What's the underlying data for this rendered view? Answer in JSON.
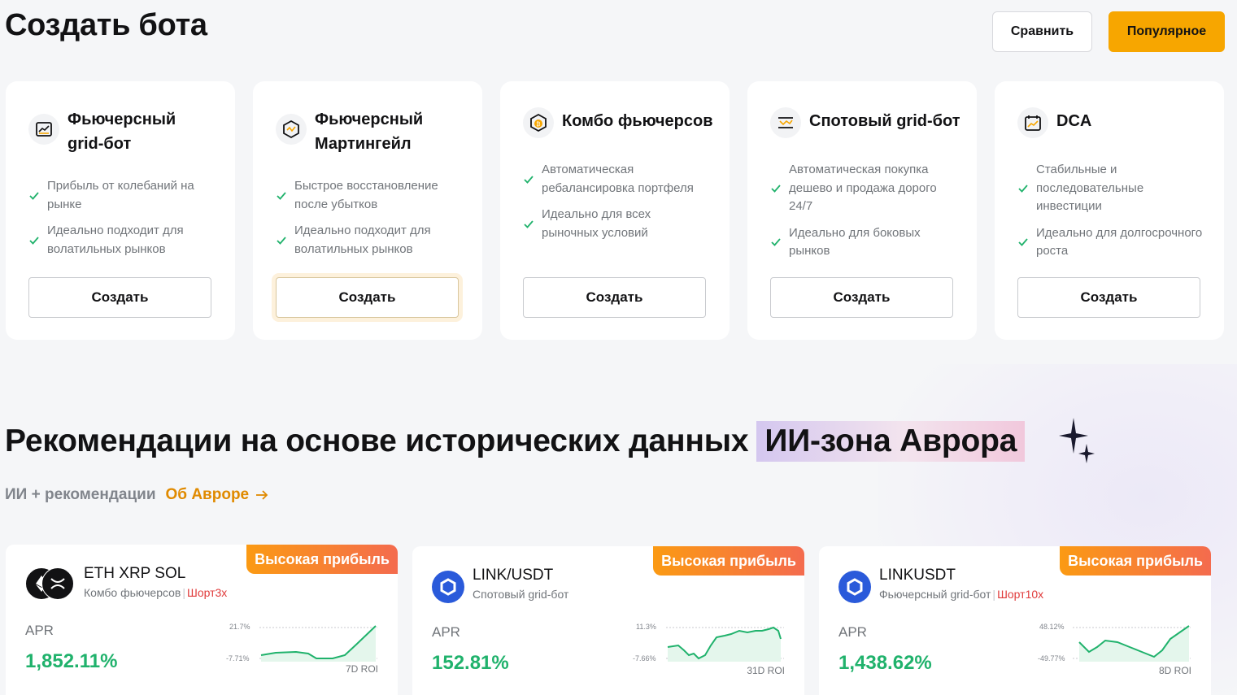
{
  "header": {
    "title": "Создать бота",
    "compare_label": "Сравнить",
    "popular_label": "Популярное"
  },
  "bots": [
    {
      "title": "Фьючерсный grid-бот",
      "icon": "futures-grid-icon",
      "features": [
        "Прибыль от колебаний на рынке",
        "Идеально подходит для волатильных рынков"
      ],
      "button": "Создать"
    },
    {
      "title": "Фьючерсный Мартингейл",
      "icon": "martingale-icon",
      "features": [
        "Быстрое восстановление после убытков",
        "Идеально подходит для волатильных рынков"
      ],
      "button": "Создать"
    },
    {
      "title": "Комбо фьючерсов",
      "icon": "combo-futures-icon",
      "features": [
        "Автоматическая ребалансировка портфеля",
        "Идеально для всех рыночных условий"
      ],
      "button": "Создать"
    },
    {
      "title": "Спотовый grid-бот",
      "icon": "spot-grid-icon",
      "features": [
        "Автоматическая покупка дешево и продажа дорого 24/7",
        "Идеально для боковых рынков"
      ],
      "button": "Создать"
    },
    {
      "title": "DCA",
      "icon": "dca-calendar-icon",
      "features": [
        "Стабильные и последовательные инвестиции",
        "Идеально для долгосрочного роста"
      ],
      "button": "Создать"
    }
  ],
  "recommendations": {
    "title_main": "Рекомендации на основе исторических данных",
    "title_highlight": "ИИ-зона Аврора",
    "subtitle": "ИИ + рекомендации",
    "about_link": "Об Авроре",
    "cards": [
      {
        "pair": "ETH XRP SOL",
        "type": "Комбо фьючерсов",
        "leverage": "Шорт3x",
        "badge": "Высокая прибыль",
        "apr_label": "APR",
        "apr": "1,852.11%",
        "roi_label": "7D ROI",
        "axis_max": "21.7%",
        "axis_min": "-7.71%"
      },
      {
        "pair": "LINK/USDT",
        "type": "Спотовый grid-бот",
        "leverage": "",
        "badge": "Высокая прибыль",
        "apr_label": "APR",
        "apr": "152.81%",
        "roi_label": "31D ROI",
        "axis_max": "11.3%",
        "axis_min": "-7.66%"
      },
      {
        "pair": "LINKUSDT",
        "type": "Фьючерсный grid-бот",
        "leverage": "Шорт10x",
        "badge": "Высокая прибыль",
        "apr_label": "APR",
        "apr": "1,438.62%",
        "roi_label": "8D ROI",
        "axis_max": "48.12%",
        "axis_min": "-49.77%"
      }
    ]
  },
  "colors": {
    "accent": "#f7a600",
    "profit_green": "#20b26c",
    "short_red": "#e03a3a",
    "link_orange": "#e08a00"
  }
}
